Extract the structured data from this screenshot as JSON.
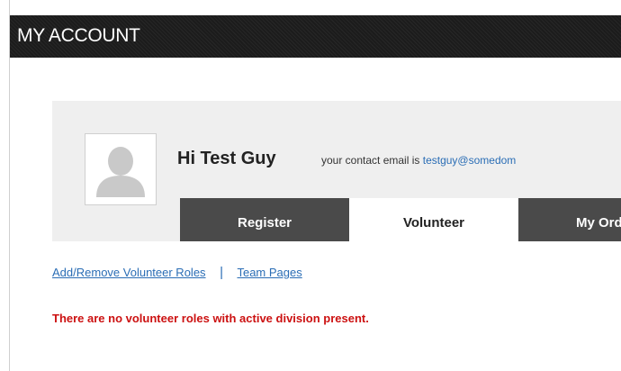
{
  "header": {
    "title": "MY ACCOUNT"
  },
  "profile": {
    "greeting": "Hi Test Guy",
    "contact_prefix": "your contact email is",
    "contact_email": "testguy@somedom"
  },
  "tabs": [
    {
      "label": "Register",
      "active": false
    },
    {
      "label": "Volunteer",
      "active": true
    },
    {
      "label": "My Orde",
      "active": false
    }
  ],
  "links": {
    "add_remove": "Add/Remove Volunteer Roles",
    "separator": "|",
    "team_pages": "Team Pages"
  },
  "message": "There are no volunteer roles with active division present.",
  "colors": {
    "header_bg": "#1f1f1f",
    "panel_bg": "#efefef",
    "tab_inactive": "#4a4a4a",
    "link": "#2a6db5",
    "error": "#cc1111"
  }
}
